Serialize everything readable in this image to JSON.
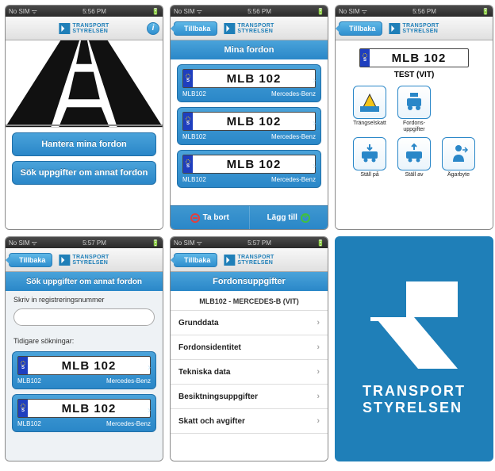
{
  "status": {
    "carrier": "No SIM",
    "wifi": "•••",
    "time1": "5:56 PM",
    "time2": "5:57 PM",
    "battery": "▮"
  },
  "brand": {
    "line1": "TRANSPORT",
    "line2": "STYRELSEN"
  },
  "nav": {
    "back": "Tillbaka",
    "info": "i"
  },
  "screen1": {
    "btn1": "Hantera mina fordon",
    "btn2": "Sök uppgifter om annat fordon"
  },
  "screen2": {
    "title": "Mina fordon",
    "vehicles": [
      {
        "plate": "MLB 102",
        "reg": "MLB102",
        "make": "Mercedes-Benz"
      },
      {
        "plate": "MLB 102",
        "reg": "MLB102",
        "make": "Mercedes-Benz"
      },
      {
        "plate": "MLB 102",
        "reg": "MLB102",
        "make": "Mercedes-Benz"
      }
    ],
    "remove": "Ta bort",
    "add": "Lägg till"
  },
  "screen3": {
    "plate": "MLB 102",
    "subtitle": "TEST (VIT)",
    "icons": [
      {
        "label": "Trängselskatt"
      },
      {
        "label": "Fordons-\nuppgifter"
      },
      {
        "label": "Ställ på"
      },
      {
        "label": "Ställ av"
      },
      {
        "label": "Ägarbyte"
      }
    ]
  },
  "screen4": {
    "title": "Sök uppgifter om annat fordon",
    "input_label": "Skriv in registreringsnummer",
    "placeholder": "",
    "history_label": "Tidigare sökningar:",
    "history": [
      {
        "plate": "MLB 102",
        "reg": "MLB102",
        "make": "Mercedes-Benz"
      },
      {
        "plate": "MLB 102",
        "reg": "MLB102",
        "make": "Mercedes-Benz"
      }
    ]
  },
  "screen5": {
    "title": "Fordonsuppgifter",
    "header": "MLB102 - MERCEDES-B (VIT)",
    "rows": [
      "Grunddata",
      "Fordonsidentitet",
      "Tekniska data",
      "Besiktningsuppgifter",
      "Skatt och avgifter"
    ]
  },
  "splash": {
    "line1": "TRANSPORT",
    "line2": "STYRELSEN"
  }
}
